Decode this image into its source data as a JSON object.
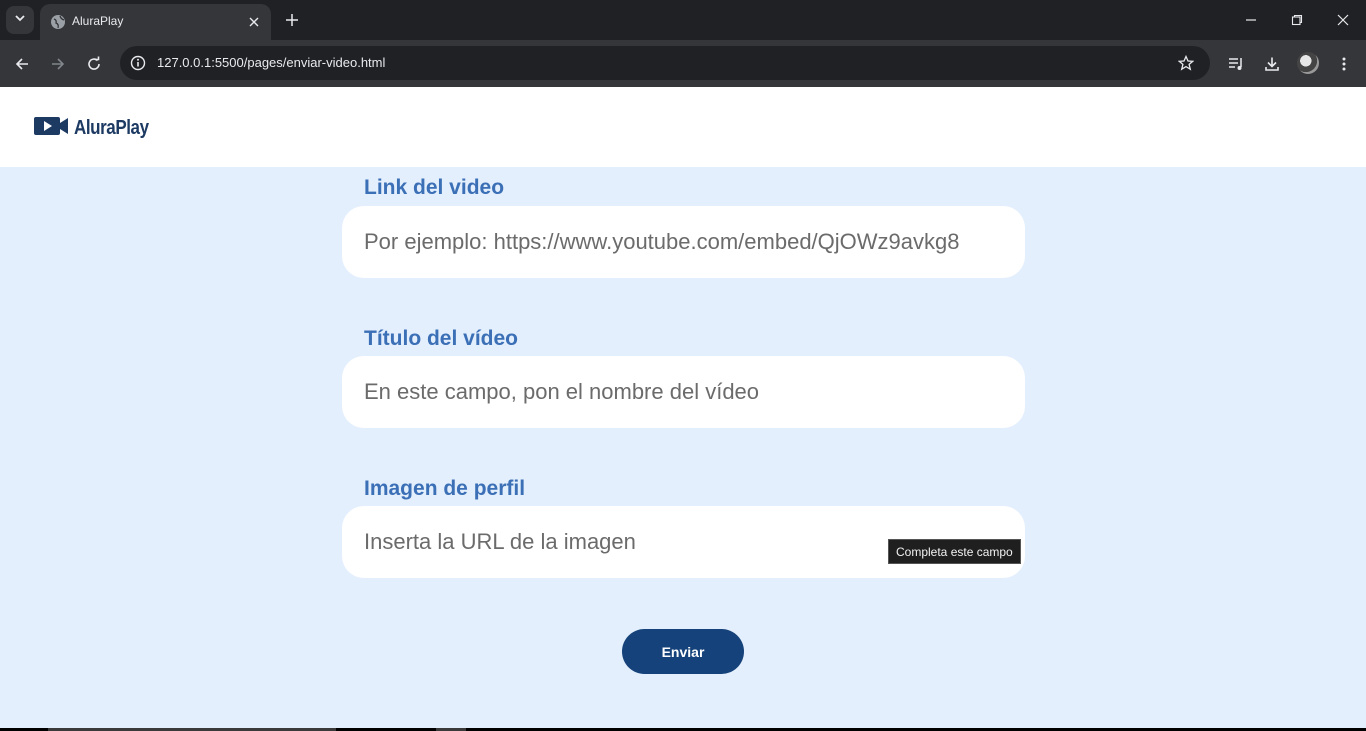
{
  "browser": {
    "tab_title": "AluraPlay",
    "url": "127.0.0.1:5500/pages/enviar-video.html"
  },
  "site": {
    "logo_text": "AluraPlay"
  },
  "form": {
    "link_label": "Link del video",
    "link_placeholder": "Por ejemplo: https://www.youtube.com/embed/QjOWz9avkg8",
    "title_label": "Título del vídeo",
    "title_placeholder": "En este campo, pon el nombre del vídeo",
    "image_label": "Imagen de perfil",
    "image_placeholder": "Inserta la URL de la imagen",
    "validation_tooltip": "Completa este campo",
    "submit_label": "Enviar"
  },
  "colors": {
    "page_background": "#e3effd",
    "label_color": "#3b6fb6",
    "button_color": "#15427a"
  }
}
